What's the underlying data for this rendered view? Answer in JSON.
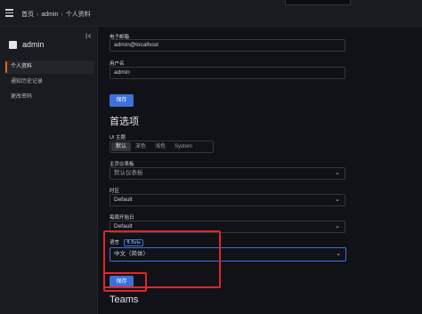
{
  "topbar": {
    "breadcrumbs": [
      "首页",
      "admin",
      "个人资料"
    ],
    "separator": "›"
  },
  "sidebar": {
    "dock_icon": "dock-left-icon",
    "user_name": "admin",
    "items": [
      {
        "label": "个人资料",
        "active": true
      },
      {
        "label": "通知历史记录",
        "active": false
      },
      {
        "label": "更改密码",
        "active": false
      }
    ]
  },
  "profile": {
    "email_label": "电子邮箱",
    "email_value": "admin@localhost",
    "username_label": "用户名",
    "username_value": "admin",
    "save_label": "保存"
  },
  "preferences": {
    "title": "首选项",
    "theme_label": "UI 主题",
    "theme_options": [
      "默认",
      "深色",
      "浅色",
      "System"
    ],
    "theme_selected": "默认",
    "home_label": "主页仪表板",
    "home_value": "默认仪表板",
    "timezone_label": "时区",
    "timezone_value": "Default",
    "week_start_label": "每周开始日",
    "week_start_value": "Default",
    "language_label": "语言",
    "beta_label": "Beta",
    "language_value": "中文（简体）",
    "save_label": "保存"
  },
  "teams": {
    "title": "Teams"
  },
  "colors": {
    "accent": "#3d71d9",
    "highlight": "#e0262b",
    "active_marker": "#f46800"
  }
}
